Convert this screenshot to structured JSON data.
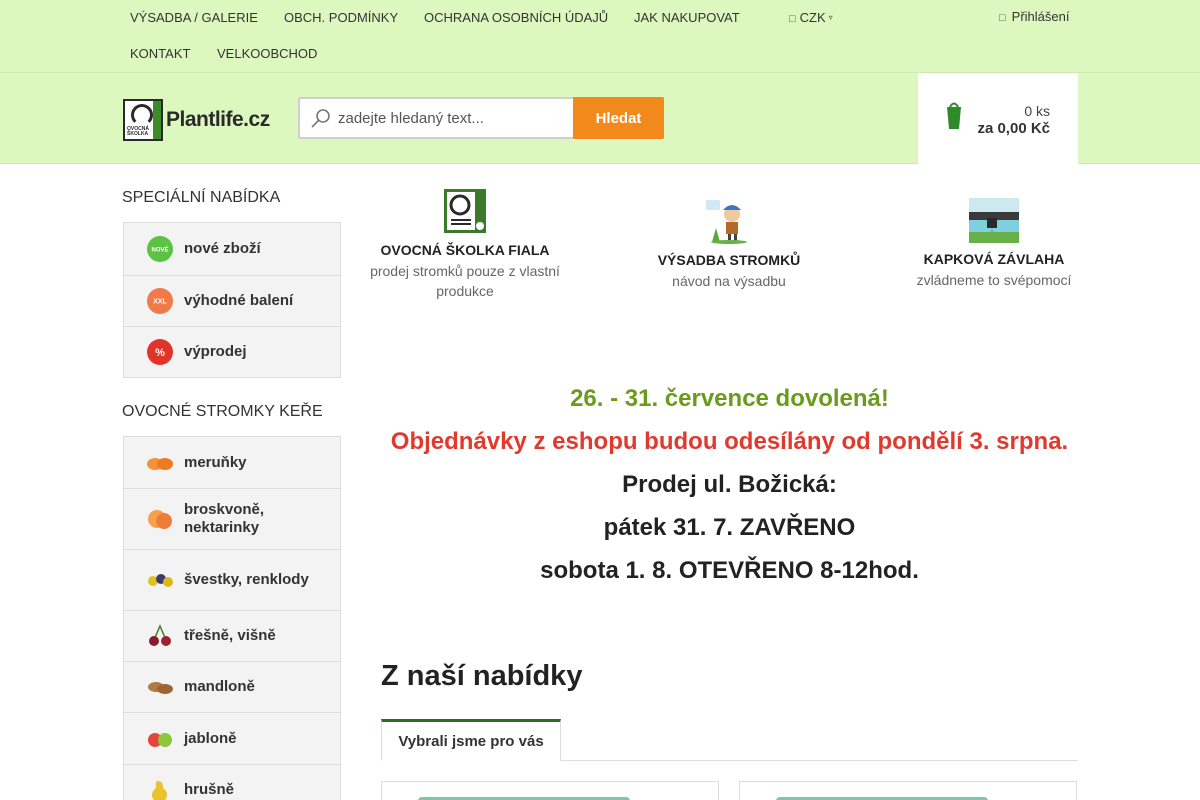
{
  "nav": {
    "links": [
      "VÝSADBA / GALERIE",
      "OBCH. PODMÍNKY",
      "OCHRANA OSOBNÍCH ÚDAJŮ",
      "JAK NAKUPOVAT",
      "KONTAKT",
      "VELKOOBCHOD"
    ],
    "currency": "CZK",
    "login": "Přihlášení"
  },
  "header": {
    "logo_text": "Plantlife.cz",
    "logo_badge": "OVOCNÁ ŠKOLKA",
    "search_placeholder": "zadejte hledaný text...",
    "search_button": "Hledat",
    "cart_count": "0 ks",
    "cart_total": "za 0,00 Kč"
  },
  "sidebar": {
    "special_heading": "SPECIÁLNÍ NABÍDKA",
    "special_items": [
      {
        "label": "nové zboží",
        "icon": "new-badge-icon",
        "badge": "NOVÉ"
      },
      {
        "label": "výhodné balení",
        "icon": "xxl-badge-icon",
        "badge": "XXL"
      },
      {
        "label": "výprodej",
        "icon": "percent-badge-icon",
        "badge": "%"
      }
    ],
    "fruit_heading": "OVOCNÉ STROMKY KEŘE",
    "fruit_items": [
      {
        "label": "meruňky",
        "icon": "apricot-icon"
      },
      {
        "label": "broskvoně, nektarinky",
        "icon": "peach-icon"
      },
      {
        "label": "švestky, renklody",
        "icon": "plum-icon"
      },
      {
        "label": "třešně, višně",
        "icon": "cherry-icon"
      },
      {
        "label": "mandloně",
        "icon": "almond-icon"
      },
      {
        "label": "jabloně",
        "icon": "apple-icon"
      },
      {
        "label": "hrušně",
        "icon": "pear-icon"
      }
    ]
  },
  "features": [
    {
      "title": "OVOCNÁ ŠKOLKA Fiala",
      "subtitle": "prodej stromků pouze z vlastní produkce",
      "icon": "nursery-logo-icon"
    },
    {
      "title": "VÝSADBA STROMKŮ",
      "subtitle": "návod na výsadbu",
      "icon": "gardener-icon"
    },
    {
      "title": "KAPKOVÁ ZÁVLAHA",
      "subtitle": "zvládneme to svépomocí",
      "icon": "drip-irrigation-icon"
    }
  ],
  "announcement": {
    "line1": "26. - 31. července dovolená!",
    "line2": "Objednávky z eshopu budou odesílány od pondělí 3. srpna.",
    "line3": "Prodej ul. Božická:",
    "line4": "pátek 31. 7. ZAVŘENO",
    "line5": "sobota 1. 8. OTEVŘENO 8-12hod."
  },
  "offer": {
    "title": "Z naší nabídky",
    "tab": "Vybrali jsme pro vás"
  },
  "colors": {
    "header_bg": "#dcf8bf",
    "accent_orange": "#f28a1b",
    "announce_green": "#6a9b1b",
    "announce_red": "#e03a2e",
    "tab_accent": "#2e6b2a"
  }
}
